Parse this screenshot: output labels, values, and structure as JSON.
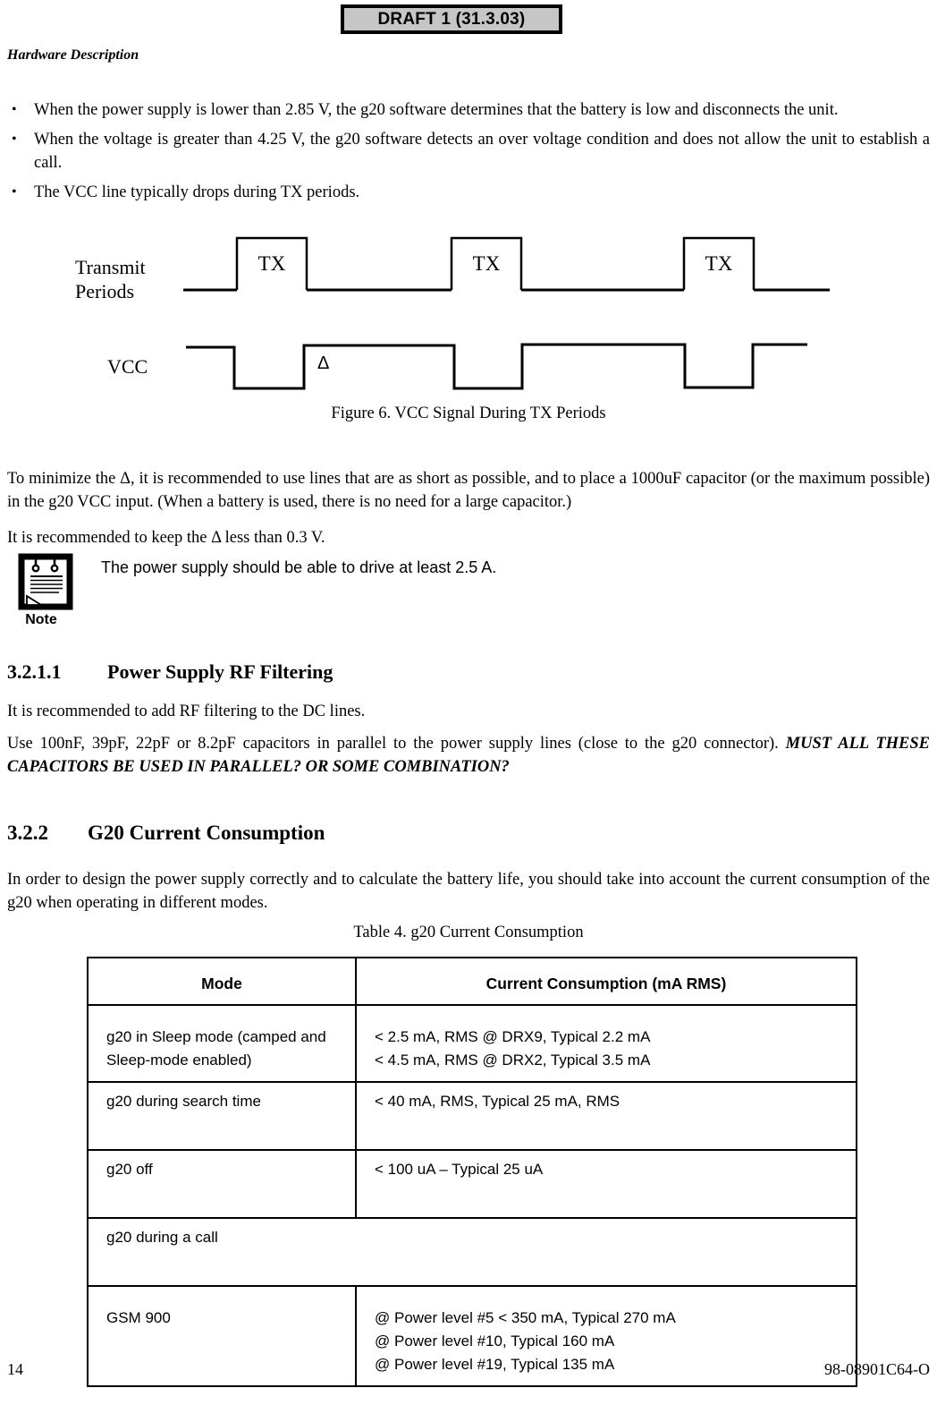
{
  "draft_banner": "DRAFT 1 (31.3.03)",
  "running_header": "Hardware Description",
  "bullets": [
    "When the power supply is lower than 2.85 V, the g20 software determines that the battery is low and disconnects the unit.",
    "When the voltage is greater than 4.25 V, the g20 software detects an over voltage condition and does not allow the unit to establish a call.",
    "The VCC line typically drops during TX periods."
  ],
  "bullet_mark": "•",
  "figure": {
    "label_transmit_line1": "Transmit",
    "label_transmit_line2": "Periods",
    "label_vcc": "VCC",
    "tx_labels": [
      "TX",
      "TX",
      "TX"
    ],
    "delta_symbol": "Δ",
    "caption": "Figure 6.  VCC Signal During TX Periods"
  },
  "paragraphs": {
    "minimize_delta": "To minimize the Δ, it is recommended to use lines that are as short as possible, and to place a 1000uF capacitor (or the maximum possible) in the g20 VCC input. (When a battery is used, there is no need for a large capacitor.)",
    "keep_delta": "It is recommended to keep the Δ less than 0.3 V.",
    "rf_filtering_intro": "It is recommended to add RF filtering to the DC lines.",
    "rf_filtering_body_normal": "Use 100nF, 39pF, 22pF or 8.2pF capacitors in parallel to the power supply lines (close to the g20 connector). ",
    "rf_filtering_body_emphasis": "MUST ALL THESE CAPACITORS BE USED IN PARALLEL? OR SOME COMBINATION?",
    "current_consumption_intro": "In order to design the power supply correctly and to calculate the battery life, you should take into account the current consumption of the g20 when operating in different modes."
  },
  "note": {
    "label": "Note",
    "text": "The power supply should be able to drive at least 2.5 A."
  },
  "headings": {
    "sec_3211_num": "3.2.1.1",
    "sec_3211_title": "Power Supply RF Filtering",
    "sec_322_num": "3.2.2",
    "sec_322_title": "G20 Current Consumption"
  },
  "table": {
    "caption": "Table 4.  g20 Current Consumption",
    "headers": [
      "Mode",
      "Current Consumption (mA RMS)"
    ],
    "rows": [
      {
        "mode_line1": "g20 in Sleep mode (camped and",
        "mode_line2": "Sleep-mode enabled)",
        "value_line1": "< 2.5 mA, RMS @ DRX9, Typical 2.2 mA",
        "value_line2": "< 4.5 mA, RMS @ DRX2, Typical 3.5 mA"
      },
      {
        "mode_line1": "g20 during search time",
        "value_line1": "< 40 mA, RMS, Typical 25 mA, RMS"
      },
      {
        "mode_line1": "g20 off",
        "value_line1": "< 100 uA – Typical 25 uA"
      },
      {
        "mode_line1": "g20 during a call",
        "value_line1": ""
      },
      {
        "mode_line1": "GSM 900",
        "value_line1": "@ Power level #5 < 350 mA, Typical 270 mA",
        "value_line2": "@ Power level #10, Typical 160 mA",
        "value_line3": "@ Power level #19, Typical 135 mA"
      }
    ]
  },
  "footer": {
    "page_number": "14",
    "document_id": "98-08901C64-O"
  },
  "colors": {
    "banner_fill": "#c6c6c6",
    "ink": "#000000",
    "page": "#ffffff"
  }
}
